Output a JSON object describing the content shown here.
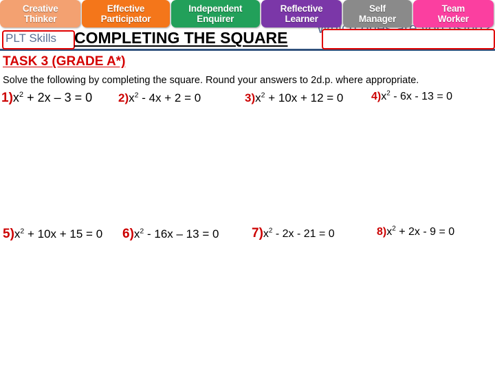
{
  "plt_strip": {
    "tabs": [
      {
        "line1": "Creative",
        "line2": "Thinker",
        "color": "#f3a171"
      },
      {
        "line1": "Effective",
        "line2": "Participator",
        "color": "#f4761a"
      },
      {
        "line1": "Independent",
        "line2": "Enquirer",
        "color": "#22a05a"
      },
      {
        "line1": "Reflective",
        "line2": "Learner",
        "color": "#7b37a8"
      },
      {
        "line1": "Self",
        "line2": "Manager",
        "color": "#8a8a8a"
      },
      {
        "line1": "Team",
        "line2": "Worker",
        "color": "#fb3fa0"
      }
    ]
  },
  "header": {
    "plt_skills_label": "PLT Skills",
    "which_ones_prompt": "Which ones are you using?",
    "title": "COMPLETING THE SQUARE",
    "right_box_value": "",
    "rule_color": "#31527d",
    "accent_red": "#e00000",
    "prompt_color": "#5a6f93"
  },
  "task": {
    "heading": "TASK 3 (GRADE A*)",
    "heading_color": "#d40000",
    "instruction": "Solve the following by completing the square. Round your answers to 2d.p. where appropriate."
  },
  "questions": [
    {
      "number": "1)",
      "lhs_coef": "x",
      "power": "2",
      "rest": " + 2x – 3 = 0"
    },
    {
      "number": "2)",
      "lhs_coef": "x",
      "power": "2",
      "rest": " - 4x + 2 = 0"
    },
    {
      "number": "3)",
      "lhs_coef": "x",
      "power": "2",
      "rest": " + 10x + 12 = 0"
    },
    {
      "number": "4)",
      "lhs_coef": "x",
      "power": "2",
      "rest": " - 6x - 13 = 0"
    },
    {
      "number": "5)",
      "lhs_coef": "x",
      "power": "2",
      "rest": " + 10x + 15 = 0"
    },
    {
      "number": "6)",
      "lhs_coef": "x",
      "power": "2",
      "rest": " - 16x – 13 = 0"
    },
    {
      "number": "7)",
      "lhs_coef": "x",
      "power": "2",
      "rest": " - 2x - 21 = 0"
    },
    {
      "number": "8)",
      "lhs_coef": "x",
      "power": "2",
      "rest": " + 2x - 9 = 0"
    }
  ]
}
